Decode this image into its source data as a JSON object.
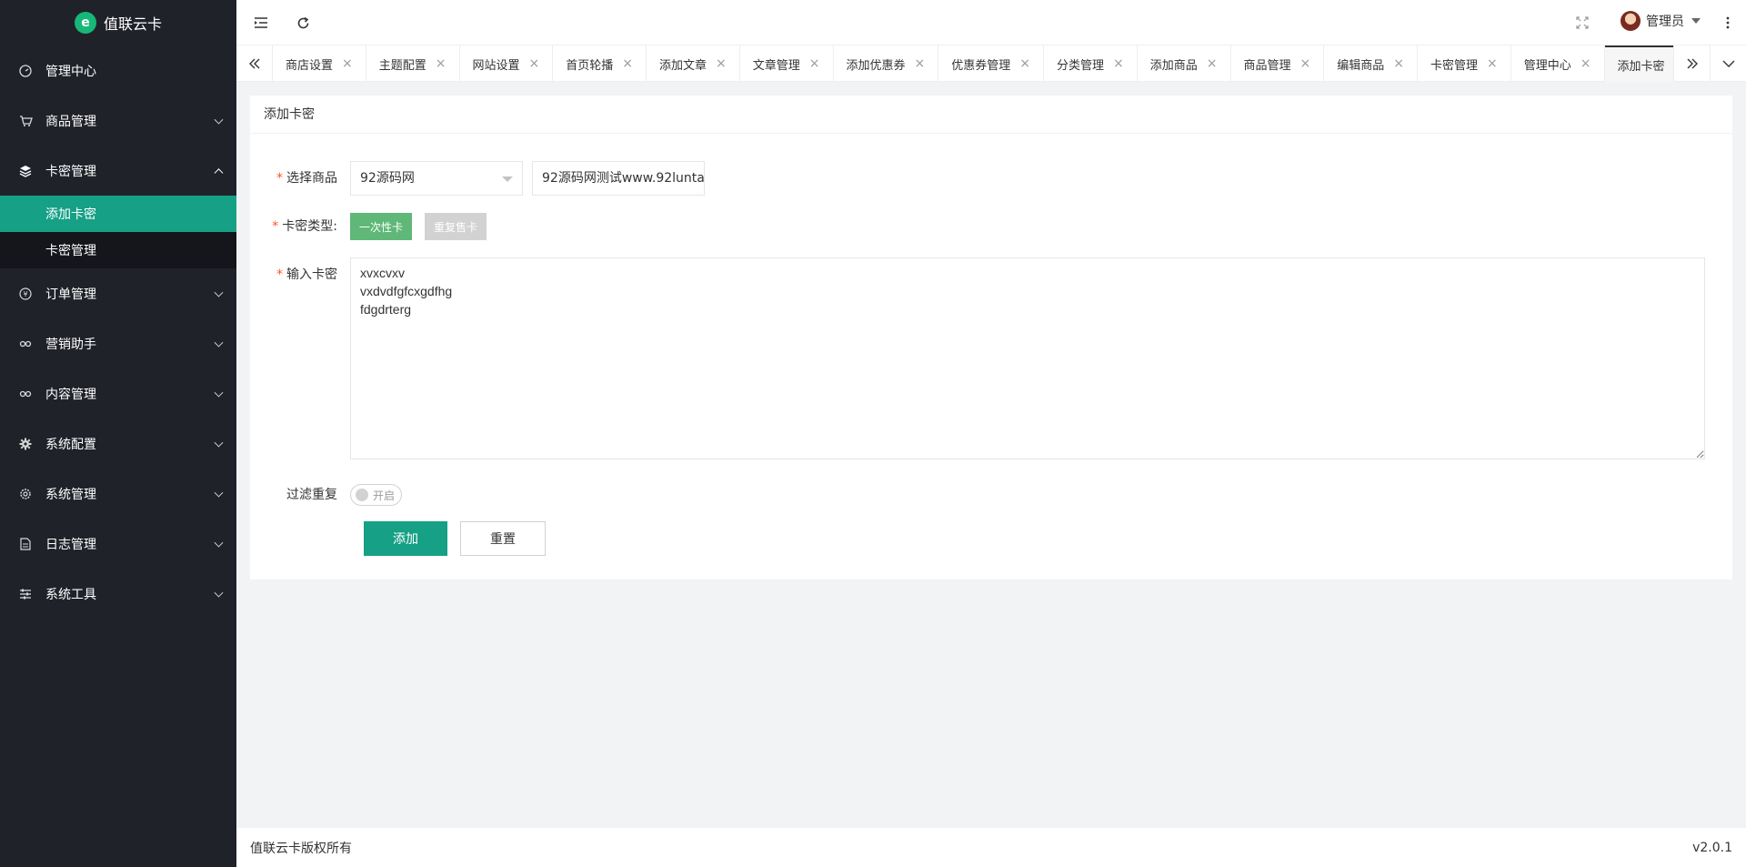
{
  "app": {
    "title": "值联云卡",
    "logo_letter": "e"
  },
  "sidebar": {
    "items": [
      {
        "label": "管理中心",
        "icon": "dashboard-icon"
      },
      {
        "label": "商品管理",
        "icon": "cart-icon"
      },
      {
        "label": "卡密管理",
        "icon": "layers-icon",
        "expanded": true,
        "children": [
          {
            "label": "添加卡密",
            "active": true
          },
          {
            "label": "卡密管理"
          }
        ]
      },
      {
        "label": "订单管理",
        "icon": "yen-icon"
      },
      {
        "label": "营销助手",
        "icon": "link-icon"
      },
      {
        "label": "内容管理",
        "icon": "link-icon"
      },
      {
        "label": "系统配置",
        "icon": "gear-icon"
      },
      {
        "label": "系统管理",
        "icon": "settings-icon"
      },
      {
        "label": "日志管理",
        "icon": "log-icon"
      },
      {
        "label": "系统工具",
        "icon": "sliders-icon"
      }
    ]
  },
  "header": {
    "user": "管理员"
  },
  "tabs": [
    {
      "label": "商店设置"
    },
    {
      "label": "主题配置"
    },
    {
      "label": "网站设置"
    },
    {
      "label": "首页轮播"
    },
    {
      "label": "添加文章"
    },
    {
      "label": "文章管理"
    },
    {
      "label": "添加优惠券"
    },
    {
      "label": "优惠券管理"
    },
    {
      "label": "分类管理"
    },
    {
      "label": "添加商品"
    },
    {
      "label": "商品管理"
    },
    {
      "label": "编辑商品"
    },
    {
      "label": "卡密管理"
    },
    {
      "label": "管理中心"
    },
    {
      "label": "添加卡密",
      "active": true
    }
  ],
  "card": {
    "title": "添加卡密",
    "product_label": "选择商品",
    "product_category": "92源码网",
    "product_name": "92源码网测试www.92lunta",
    "type_label": "卡密类型:",
    "type_once": "一次性卡",
    "type_repeat": "重复售卡",
    "cards_label": "输入卡密",
    "cards_value": "xvxcvxv\nvxdvdfgfcxgdfhg\nfdgdrterg",
    "filter_label": "过滤重复",
    "filter_switch_text": "开启",
    "add_button": "添加",
    "reset_button": "重置"
  },
  "footer": {
    "copyright": "值联云卡版权所有",
    "version": "v2.0.1"
  },
  "colors": {
    "accent": "#16a085",
    "sidebar_bg": "#20222a",
    "submenu_bg": "#14161b",
    "once_btn": "#5fb878",
    "logo": "#16b777"
  }
}
